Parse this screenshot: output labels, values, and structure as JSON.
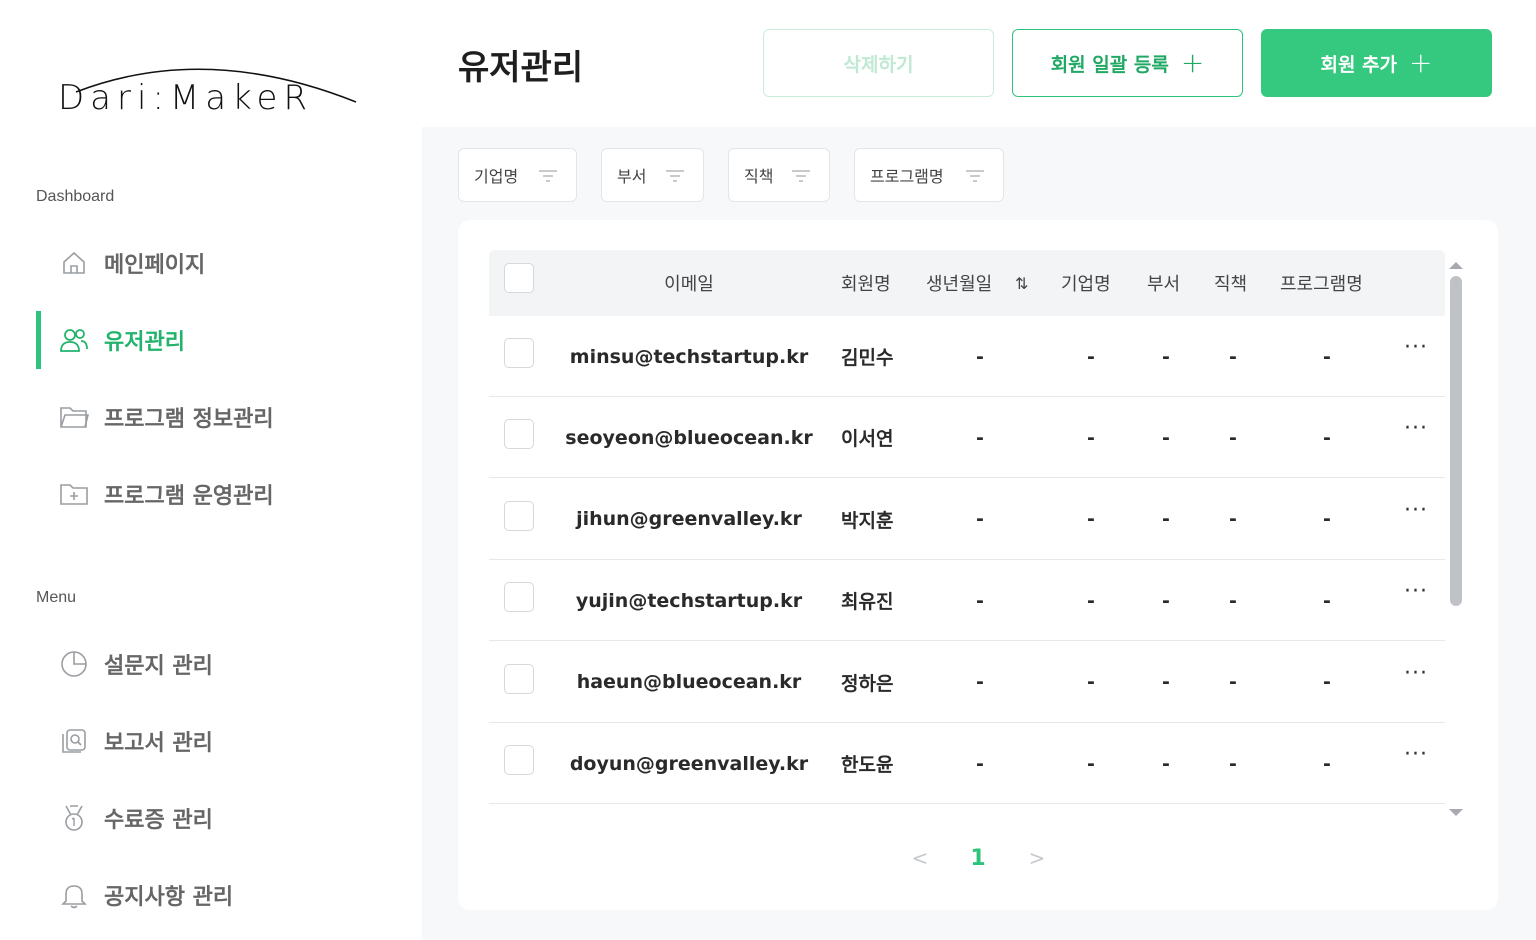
{
  "sidebar": {
    "logo_text": "Dari:MakeR",
    "dashboard_label": "Dashboard",
    "menu_label": "Menu",
    "dashboard_items": [
      {
        "label": "메인페이지",
        "icon": "home-icon",
        "active": false
      },
      {
        "label": "유저관리",
        "icon": "users-icon",
        "active": true
      },
      {
        "label": "프로그램 정보관리",
        "icon": "folder-icon",
        "active": false
      },
      {
        "label": "프로그램 운영관리",
        "icon": "folder-plus-icon",
        "active": false
      }
    ],
    "menu_items": [
      {
        "label": "설문지 관리",
        "icon": "pie-chart-icon"
      },
      {
        "label": "보고서 관리",
        "icon": "report-search-icon"
      },
      {
        "label": "수료증 관리",
        "icon": "medal-icon"
      },
      {
        "label": "공지사항 관리",
        "icon": "bell-icon"
      }
    ]
  },
  "header": {
    "title": "유저관리",
    "delete_label": "삭제하기",
    "bulk_label": "회원 일괄 등록",
    "add_label": "회원 추가",
    "plus": "+"
  },
  "filters": [
    "기업명",
    "부서",
    "직책",
    "프로그램명"
  ],
  "table": {
    "columns": {
      "email": "이메일",
      "name": "회원명",
      "birth": "생년월일",
      "sort_glyph": "⇅",
      "company": "기업명",
      "dept": "부서",
      "position": "직책",
      "program": "프로그램명"
    },
    "rows": [
      {
        "email": "minsu@techstartup.kr",
        "name": "김민수",
        "birth": "-",
        "company": "-",
        "dept": "-",
        "position": "-",
        "program": "-"
      },
      {
        "email": "seoyeon@blueocean.kr",
        "name": "이서연",
        "birth": "-",
        "company": "-",
        "dept": "-",
        "position": "-",
        "program": "-"
      },
      {
        "email": "jihun@greenvalley.kr",
        "name": "박지훈",
        "birth": "-",
        "company": "-",
        "dept": "-",
        "position": "-",
        "program": "-"
      },
      {
        "email": "yujin@techstartup.kr",
        "name": "최유진",
        "birth": "-",
        "company": "-",
        "dept": "-",
        "position": "-",
        "program": "-"
      },
      {
        "email": "haeun@blueocean.kr",
        "name": "정하은",
        "birth": "-",
        "company": "-",
        "dept": "-",
        "position": "-",
        "program": "-"
      },
      {
        "email": "doyun@greenvalley.kr",
        "name": "한도윤",
        "birth": "-",
        "company": "-",
        "dept": "-",
        "position": "-",
        "program": "-"
      }
    ],
    "more_glyph": "···"
  },
  "pagination": {
    "prev": "<",
    "current": "1",
    "next": ">"
  },
  "colors": {
    "accent": "#2ec37c",
    "accent_dark": "#22a865",
    "muted_accent": "#bfe9d2"
  }
}
